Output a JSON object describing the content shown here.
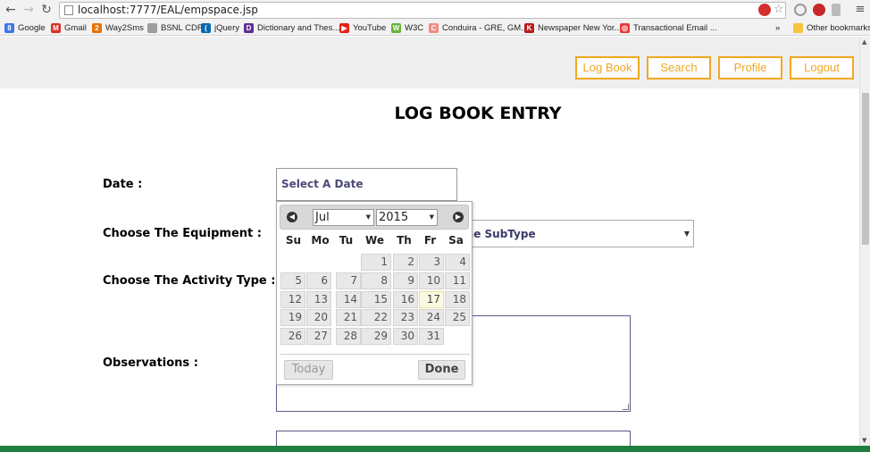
{
  "browser": {
    "url": "localhost:7777/EAL/empspace.jsp",
    "bookmarks": [
      {
        "label": "Google",
        "color": "#3b78e7",
        "glyph": "8"
      },
      {
        "label": "Gmail",
        "color": "#d93025",
        "glyph": "M"
      },
      {
        "label": "Way2Sms",
        "color": "#e8710a",
        "glyph": "2"
      },
      {
        "label": "BSNL CDR",
        "color": "#9e9e9e",
        "glyph": ""
      },
      {
        "label": "jQuery",
        "color": "#0769ad",
        "glyph": "("
      },
      {
        "label": "Dictionary and Thes...",
        "color": "#5c2d91",
        "glyph": "D"
      },
      {
        "label": "YouTube",
        "color": "#e62117",
        "glyph": "▶"
      },
      {
        "label": "W3C",
        "color": "#6bb13b",
        "glyph": "W"
      },
      {
        "label": "Conduira - GRE, GM...",
        "color": "#f28b82",
        "glyph": "C"
      },
      {
        "label": "Newspaper New Yor...",
        "color": "#b71c1c",
        "glyph": "K"
      },
      {
        "label": "Transactional Email ...",
        "color": "#e53935",
        "glyph": "◎"
      }
    ],
    "more_bookmarks": "»",
    "other_bookmarks": "Other bookmarks"
  },
  "header": {
    "buttons": [
      {
        "label": "Log Book"
      },
      {
        "label": "Search"
      },
      {
        "label": "Profile"
      },
      {
        "label": "Logout"
      }
    ],
    "accent": "#f0a820"
  },
  "form": {
    "title": "LOG BOOK ENTRY",
    "date_label": "Date :",
    "date_placeholder": "Select A Date",
    "equipment_label": "Choose The Equipment :",
    "subtype_value": "t the SubType",
    "activity_label": "Choose The Activity Type :",
    "observations_label": "Observations :"
  },
  "datepicker": {
    "month": "Jul",
    "year": "2015",
    "weekdays": [
      "Su",
      "Mo",
      "Tu",
      "We",
      "Th",
      "Fr",
      "Sa"
    ],
    "weeks": [
      [
        "",
        "",
        "",
        "1",
        "2",
        "3",
        "4"
      ],
      [
        "5",
        "6",
        "7",
        "8",
        "9",
        "10",
        "11"
      ],
      [
        "12",
        "13",
        "14",
        "15",
        "16",
        "17",
        "18"
      ],
      [
        "19",
        "20",
        "21",
        "22",
        "23",
        "24",
        "25"
      ],
      [
        "26",
        "27",
        "28",
        "29",
        "30",
        "31",
        ""
      ]
    ],
    "today": "17",
    "today_button": "Today",
    "done_button": "Done"
  }
}
